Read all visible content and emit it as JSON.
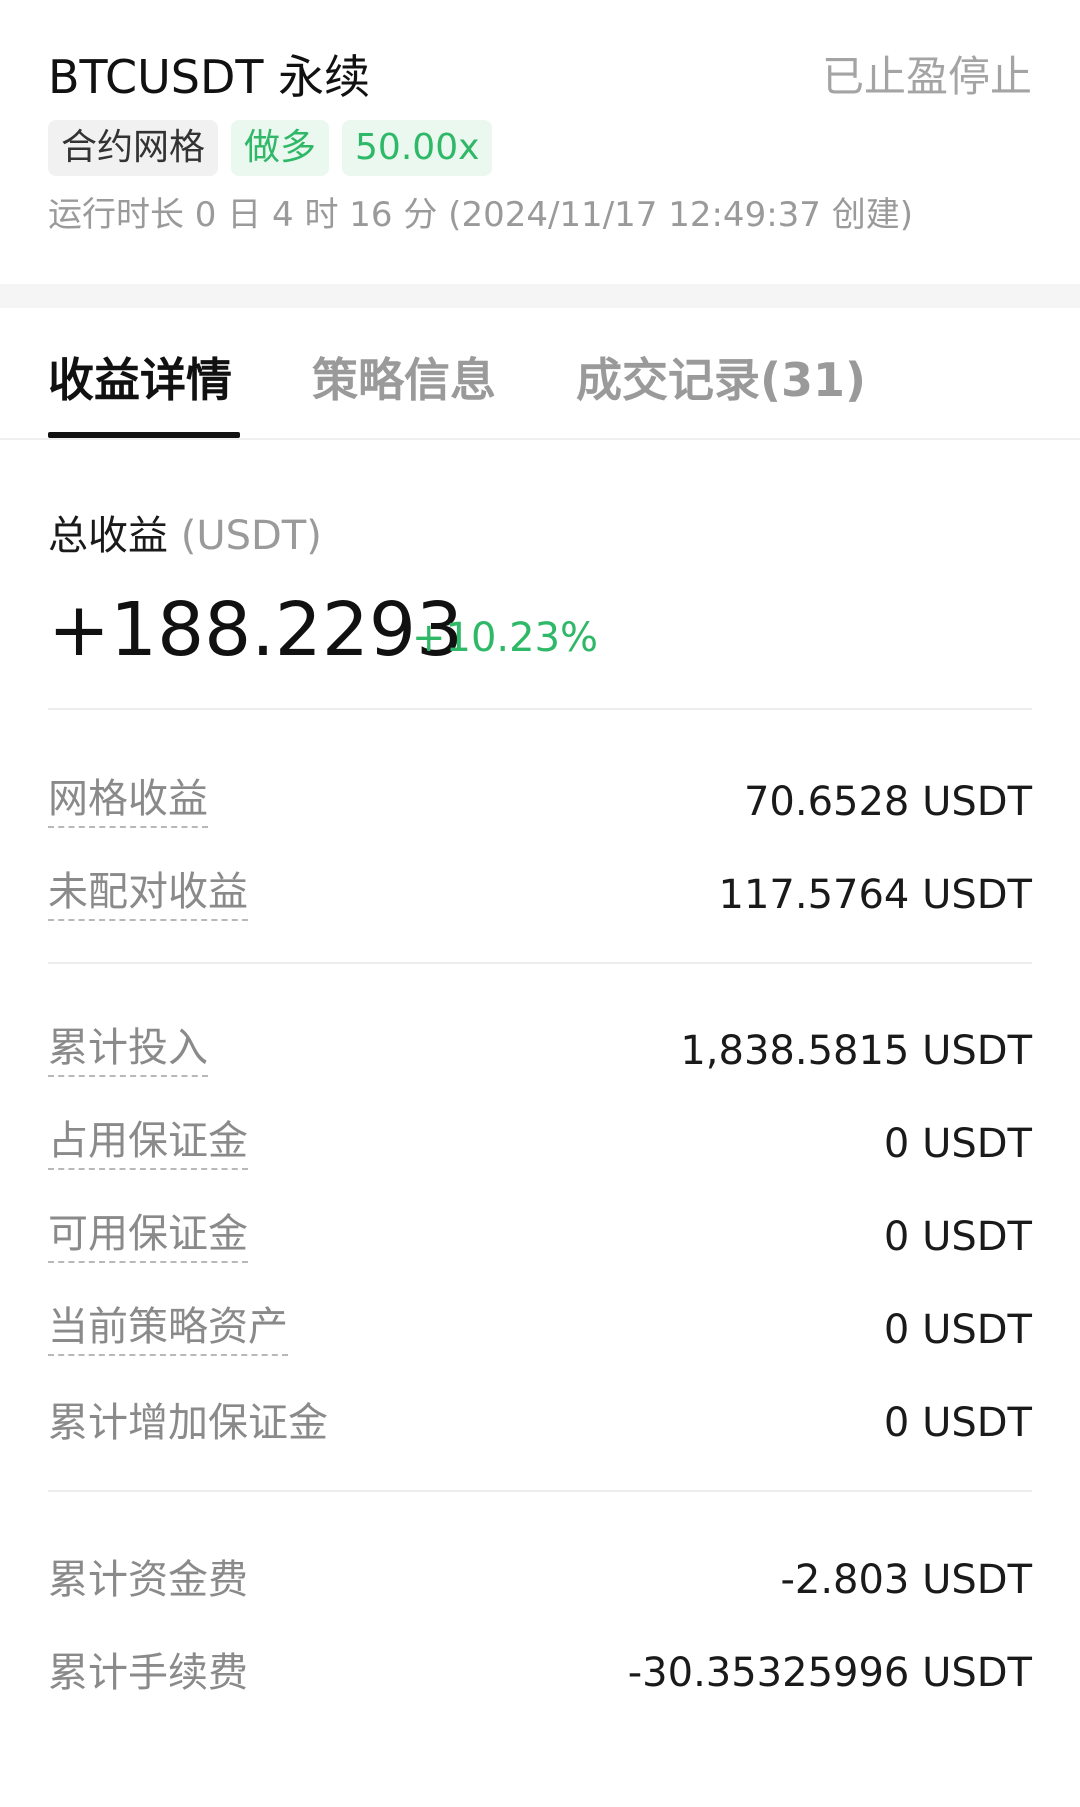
{
  "header": {
    "title": "BTCUSDT 永续",
    "status": "已止盈停止",
    "tags": {
      "type": "合约网格",
      "direction": "做多",
      "leverage": "50.00x"
    },
    "runtime": "运行时长 0 日 4 时 16 分 (2024/11/17 12:49:37 创建)"
  },
  "tabs": [
    {
      "label": "收益详情",
      "active": true
    },
    {
      "label": "策略信息",
      "active": false
    },
    {
      "label": "成交记录(31)",
      "active": false
    }
  ],
  "summary": {
    "label": "总收益",
    "unit": "(USDT)",
    "value": "+188.2293",
    "percent": "+10.23%"
  },
  "groups": {
    "profit": [
      {
        "label": "网格收益",
        "value": "70.6528 USDT"
      },
      {
        "label": "未配对收益",
        "value": "117.5764 USDT"
      }
    ],
    "capital": [
      {
        "label": "累计投入",
        "value": "1,838.5815 USDT"
      },
      {
        "label": "占用保证金",
        "value": "0 USDT"
      },
      {
        "label": "可用保证金",
        "value": "0 USDT"
      },
      {
        "label": "当前策略资产",
        "value": "0 USDT"
      },
      {
        "label": "累计增加保证金",
        "value": "0 USDT"
      }
    ],
    "fees": [
      {
        "label": "累计资金费",
        "value": "-2.803 USDT"
      },
      {
        "label": "累计手续费",
        "value": "-30.35325996 USDT"
      }
    ]
  },
  "colors": {
    "positive": "#2fb867",
    "muted": "#9a9a9a",
    "text": "#111111"
  }
}
